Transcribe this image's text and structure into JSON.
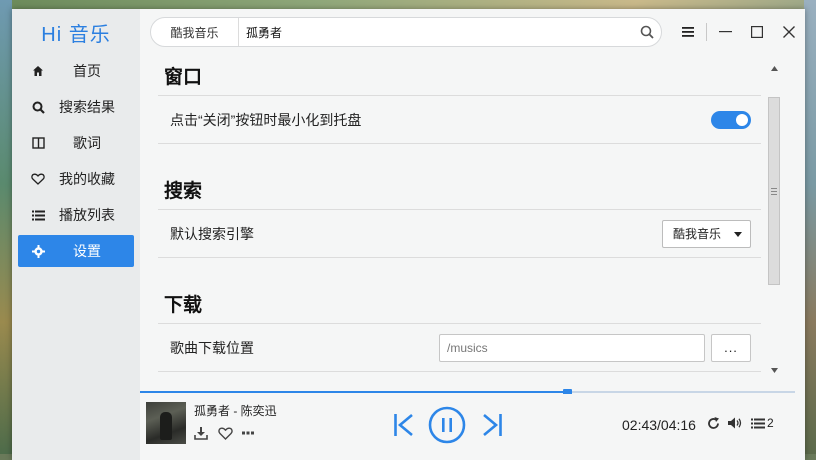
{
  "app": {
    "logo": "Hi 音乐"
  },
  "sidebar": {
    "items": [
      {
        "label": "首页",
        "icon": "home-icon",
        "active": false
      },
      {
        "label": "搜索结果",
        "icon": "search-icon",
        "active": false
      },
      {
        "label": "歌词",
        "icon": "lyrics-icon",
        "active": false
      },
      {
        "label": "我的收藏",
        "icon": "heart-icon",
        "active": false
      },
      {
        "label": "播放列表",
        "icon": "list-icon",
        "active": false
      },
      {
        "label": "设置",
        "icon": "gear-icon",
        "active": true
      }
    ]
  },
  "search": {
    "engine": "酷我音乐",
    "query": "孤勇者"
  },
  "settings": {
    "window": {
      "title": "窗口",
      "close_to_tray_label": "点击“关闭”按钮时最小化到托盘",
      "close_to_tray_enabled": true
    },
    "search": {
      "title": "搜索",
      "default_engine_label": "默认搜索引擎",
      "default_engine_value": "酷我音乐"
    },
    "download": {
      "title": "下载",
      "location_label": "歌曲下载位置",
      "location_placeholder": "/musics",
      "browse_label": "..."
    }
  },
  "player": {
    "song": "孤勇者 - 陈奕迅",
    "current_time": "02:43",
    "total_time": "04:16",
    "time_display": "02:43/04:16",
    "progress": 0.652,
    "queue_count": "2"
  },
  "colors": {
    "accent": "#2d86e8",
    "sidebar_bg": "#e9ebec"
  }
}
